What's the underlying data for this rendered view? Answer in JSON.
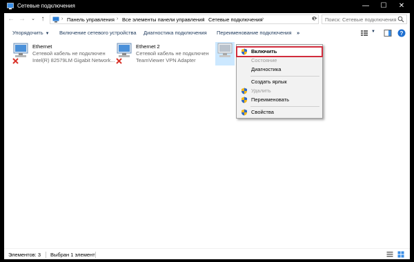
{
  "window": {
    "title": "Сетевые подключения",
    "controls": {
      "minimize": "—",
      "maximize": "☐",
      "close": "✕"
    }
  },
  "address": {
    "breadcrumbs": [
      "Панель управления",
      "Все элементы панели управления",
      "Сетевые подключения"
    ],
    "search_placeholder": "Поиск: Сетевые подключения"
  },
  "commands": {
    "organize": "Упорядочить",
    "enable_device": "Включение сетевого устройства",
    "diagnose": "Диагностика подключения",
    "rename": "Переименование подключения",
    "more": "»"
  },
  "connections": [
    {
      "name": "Ethernet",
      "status": "Сетевой кабель не подключен",
      "device": "Intel(R) 82579LM Gigabit Network..."
    },
    {
      "name": "Ethernet 2",
      "status": "Сетевой кабель не подключен",
      "device": "TeamViewer VPN Adapter"
    }
  ],
  "context_menu": {
    "enable": "Включить",
    "state": "Состояние",
    "diagnose": "Диагностика",
    "create_shortcut": "Создать ярлык",
    "delete": "Удалить",
    "rename": "Переименовать",
    "properties": "Свойства"
  },
  "statusbar": {
    "items_count": "Элементов: 3",
    "selected": "Выбран 1 элемент"
  },
  "colors": {
    "highlight_border": "#d12c3c",
    "link_text": "#1e395b"
  }
}
